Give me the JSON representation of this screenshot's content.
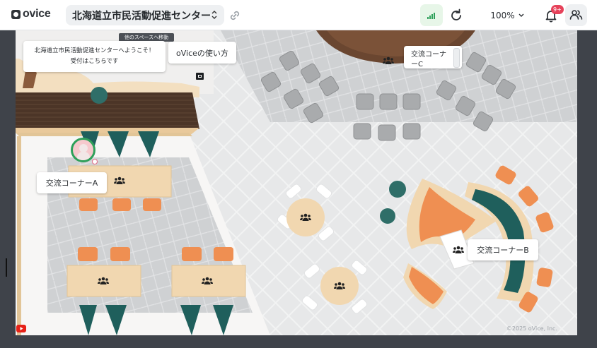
{
  "app": {
    "logo_text": "ovice",
    "space_name": "北海道立市民活動促進センター",
    "zoom_level": "100%",
    "notification_badge": "9+"
  },
  "map": {
    "move_chip": "他のスペースへ移動",
    "welcome_line1": "北海道立市民活動促進センターへようこそ！",
    "welcome_line2": "受付はこちらです",
    "howto_label": "oViceの使い方",
    "corner_a": "交流コーナーA",
    "corner_b": "交流コーナーB",
    "corner_c": "交流コーナーC",
    "copyright": "©2025 oVice, Inc."
  },
  "colors": {
    "accent_green": "#2fa05a",
    "chair_orange": "#ef8f52",
    "teal": "#1f5f5c",
    "wood": "#f1d7b0",
    "badge": "#e6425a"
  },
  "icons": [
    "space-selector-chevron-icon",
    "link-icon",
    "signal-icon",
    "reload-icon",
    "zoom-chevron-icon",
    "bell-icon",
    "members-icon",
    "people-icon",
    "embed-icon",
    "youtube-icon"
  ]
}
